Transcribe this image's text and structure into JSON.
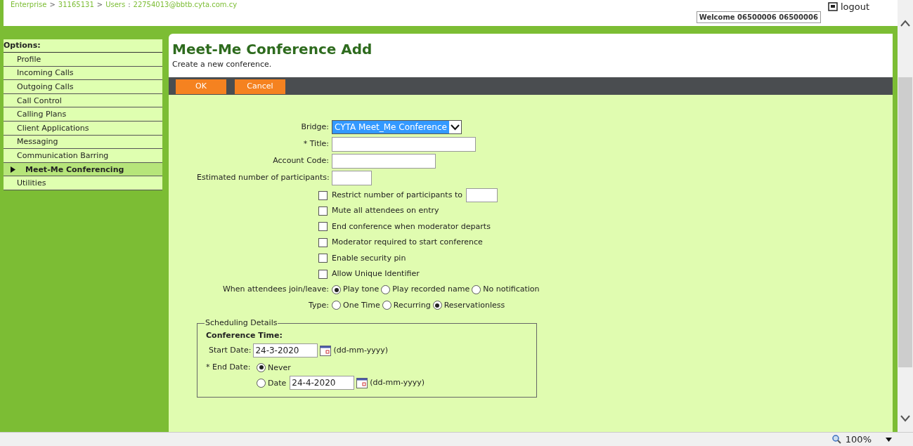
{
  "header": {
    "breadcrumb": [
      {
        "kind": "link",
        "text": "Enterprise"
      },
      {
        "kind": "sep",
        "text": ">"
      },
      {
        "kind": "link",
        "text": "31165131"
      },
      {
        "kind": "sep",
        "text": ">"
      },
      {
        "kind": "link",
        "text": "Users"
      },
      {
        "kind": "sep",
        "text": ":"
      },
      {
        "kind": "link",
        "text": "22754013@bbtb.cyta.com.cy"
      }
    ],
    "welcome": "Welcome 06500006 06500006",
    "logout": "logout"
  },
  "sidebar": {
    "heading": "Options:",
    "items": [
      {
        "label": "Profile",
        "selected": false
      },
      {
        "label": "Incoming Calls",
        "selected": false
      },
      {
        "label": "Outgoing Calls",
        "selected": false
      },
      {
        "label": "Call Control",
        "selected": false
      },
      {
        "label": "Calling Plans",
        "selected": false
      },
      {
        "label": "Client Applications",
        "selected": false
      },
      {
        "label": "Messaging",
        "selected": false
      },
      {
        "label": "Communication Barring",
        "selected": false
      },
      {
        "label": "Meet-Me Conferencing",
        "selected": true
      },
      {
        "label": "Utilities",
        "selected": false
      }
    ]
  },
  "page": {
    "title": "Meet-Me Conference Add",
    "subtitle": "Create a new conference.",
    "buttons": [
      "OK",
      "Cancel"
    ]
  },
  "form": {
    "bridge": {
      "label": "Bridge:",
      "value": "CYTA Meet_Me Conference"
    },
    "fields": [
      {
        "label": "* Title:"
      },
      {
        "label": "Account Code:"
      },
      {
        "label": "Estimated number of participants:"
      }
    ],
    "checkboxes": [
      {
        "label": "Restrict number of participants to",
        "checked": false,
        "kind": "with-field"
      },
      {
        "label": "Mute all attendees on entry",
        "checked": false,
        "kind": "plain"
      },
      {
        "label": "End conference when moderator departs",
        "checked": false,
        "kind": "plain"
      },
      {
        "label": "Moderator required to start conference",
        "checked": false,
        "kind": "plain"
      },
      {
        "label": "Enable security pin",
        "checked": false,
        "kind": "plain"
      },
      {
        "label": "Allow Unique Identifier",
        "checked": false,
        "kind": "plain"
      }
    ],
    "radio_groups": [
      {
        "label": "When attendees join/leave:",
        "options": [
          {
            "label": "Play tone",
            "selected": true
          },
          {
            "label": "Play recorded name",
            "selected": false
          },
          {
            "label": "No notification",
            "selected": false
          }
        ]
      },
      {
        "label": "Type:",
        "options": [
          {
            "label": "One Time",
            "selected": false
          },
          {
            "label": "Recurring",
            "selected": false
          },
          {
            "label": "Reservationless",
            "selected": true
          }
        ]
      }
    ]
  },
  "scheduling": {
    "legend": "Scheduling Details",
    "heading": "Conference Time:",
    "start_label": "Start Date:",
    "start_value": "24-3-2020",
    "format_hint_1": "(dd-mm-yyyy)",
    "end_label": "* End Date:",
    "end_options": [
      {
        "label": "Never",
        "selected": true,
        "kind": "plain"
      },
      {
        "label": "Date",
        "selected": false,
        "kind": "date",
        "value": "24-4-2020",
        "format_hint": "(dd-mm-yyyy)"
      }
    ]
  },
  "status_bar": {
    "zoom": "100%"
  }
}
